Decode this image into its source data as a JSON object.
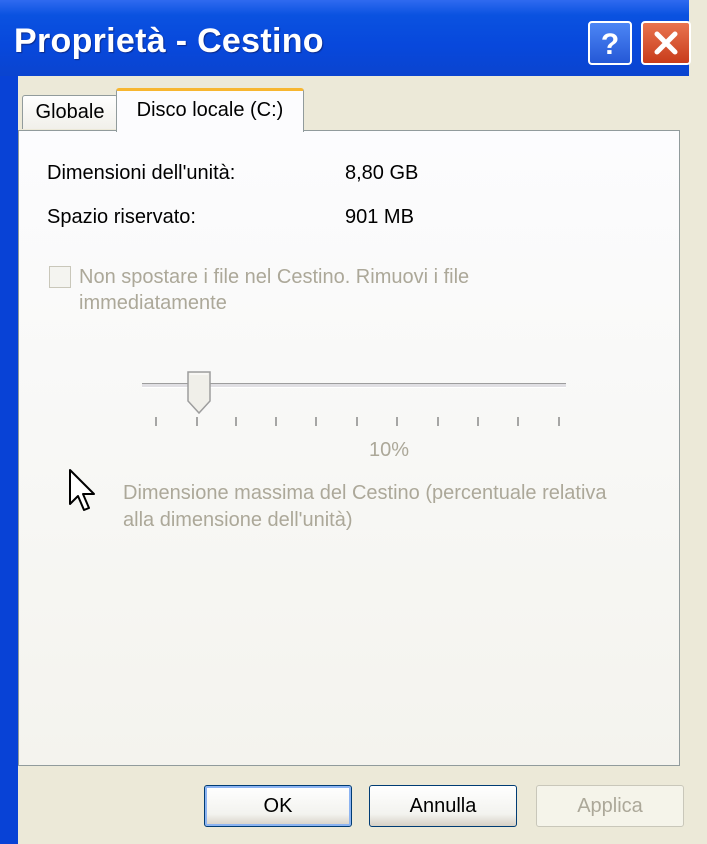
{
  "window": {
    "title": "Proprietà - Cestino"
  },
  "titlebar_buttons": {
    "help": "help-icon",
    "close": "close-icon"
  },
  "tabs": [
    {
      "label": "Globale",
      "selected": false
    },
    {
      "label": "Disco locale (C:)",
      "selected": true
    }
  ],
  "info": {
    "drive_size_label": "Dimensioni dell'unità:",
    "drive_size_value": "8,80 GB",
    "reserved_label": "Spazio riservato:",
    "reserved_value": "901 MB"
  },
  "options": {
    "no_recycle_label_line1": "Non spostare i file nel Cestino. Rimuovi i file",
    "no_recycle_label_line2": "immediatamente",
    "no_recycle_checked": false,
    "no_recycle_enabled": false
  },
  "slider": {
    "value_percent": 10,
    "value_label": "10%",
    "description_line1": "Dimensione massima del Cestino (percentuale relativa",
    "description_line2": "alla dimensione dell'unità)",
    "enabled": false
  },
  "buttons": {
    "ok": "OK",
    "cancel": "Annulla",
    "apply": "Applica"
  },
  "colors": {
    "titlebar": "#0a52e0",
    "dialog_bg": "#ece9d8",
    "disabled_text": "#aca899",
    "tab_highlight": "#f7b630"
  }
}
